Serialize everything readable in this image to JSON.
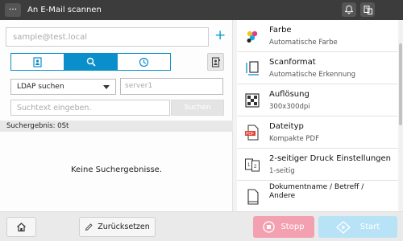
{
  "topbar": {
    "menu_label": "···",
    "title": "An E-Mail scannen",
    "bell_icon": "bell-icon",
    "device_icon": "device-status-icon"
  },
  "left": {
    "email_placeholder": "sample@test.local",
    "add_label": "+",
    "tabs": [
      {
        "icon": "address-book-icon"
      },
      {
        "icon": "search-icon"
      },
      {
        "icon": "history-clock-icon"
      }
    ],
    "side_button_icon": "address-book-detail-icon",
    "ldap_select": "LDAP  suchen",
    "server_placeholder": "server1",
    "search_placeholder": "Suchtext  eingeben.",
    "search_button": "Suchen",
    "result_label": "Suchergebnis:  0St",
    "no_results": "Keine  Suchergebnisse."
  },
  "settings": [
    {
      "label": "Farbe",
      "value": "Automatische  Farbe",
      "icon": "color-icon"
    },
    {
      "label": "Scanformat",
      "value": "Automatische  Erkennung",
      "icon": "scan-format-icon"
    },
    {
      "label": "Auflösung",
      "value": "300x300dpi",
      "icon": "resolution-icon"
    },
    {
      "label": "Dateityp",
      "value": "Kompakte  PDF",
      "icon": "pdf-file-icon"
    },
    {
      "label": "2-seitiger  Druck  Einstellungen",
      "value": "1-seitig",
      "icon": "duplex-icon"
    },
    {
      "label": "Dokumentname  /  Betreff  /\nAndere",
      "value": "",
      "icon": "document-icon"
    }
  ],
  "bottom": {
    "home_icon": "home-icon",
    "reset_label": "Zurücksetzen",
    "stop_label": "Stopp",
    "start_label": "Start"
  },
  "colors": {
    "accent": "#0b8fcb",
    "stop": "#f3a1b1",
    "start": "#b8e3f7",
    "topbar": "#3c3c3c"
  }
}
